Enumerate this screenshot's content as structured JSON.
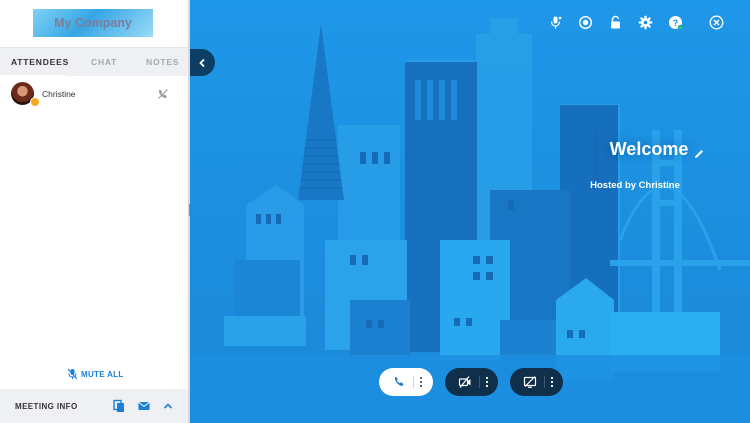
{
  "logo": {
    "text": "My Company"
  },
  "sidebar": {
    "tabs": [
      {
        "label": "ATTENDEES",
        "active": true
      },
      {
        "label": "CHAT",
        "active": false
      },
      {
        "label": "NOTES",
        "active": false
      }
    ],
    "attendees": [
      {
        "name": "Christine",
        "role_icon": "host-crown-icon",
        "audio_icon": "phone-disconnected-icon"
      }
    ],
    "mute_all": {
      "label": "MUTE ALL",
      "icon": "mic-muted-icon"
    },
    "meeting_info": {
      "label": "MEETING INFO",
      "icons": [
        "copy-icon",
        "mail-icon",
        "chevron-up-icon"
      ]
    }
  },
  "toolbar": {
    "icons": [
      "microphone-icon",
      "record-icon",
      "unlock-icon",
      "settings-gear-icon",
      "help-icon",
      "close-icon"
    ]
  },
  "stage": {
    "title": "Welcome",
    "hosted_by": "Hosted by Christine"
  },
  "controls": [
    {
      "name": "audio",
      "icon": "phone-icon",
      "style": "light"
    },
    {
      "name": "video",
      "icon": "camera-off-icon",
      "style": "dark"
    },
    {
      "name": "screenshare",
      "icon": "screenshare-off-icon",
      "style": "dark"
    }
  ],
  "colors": {
    "accent": "#1a7fd6",
    "stage_background": "#1b91e3",
    "control_dark": "#0f2f4a",
    "host_badge": "#f2a922"
  }
}
